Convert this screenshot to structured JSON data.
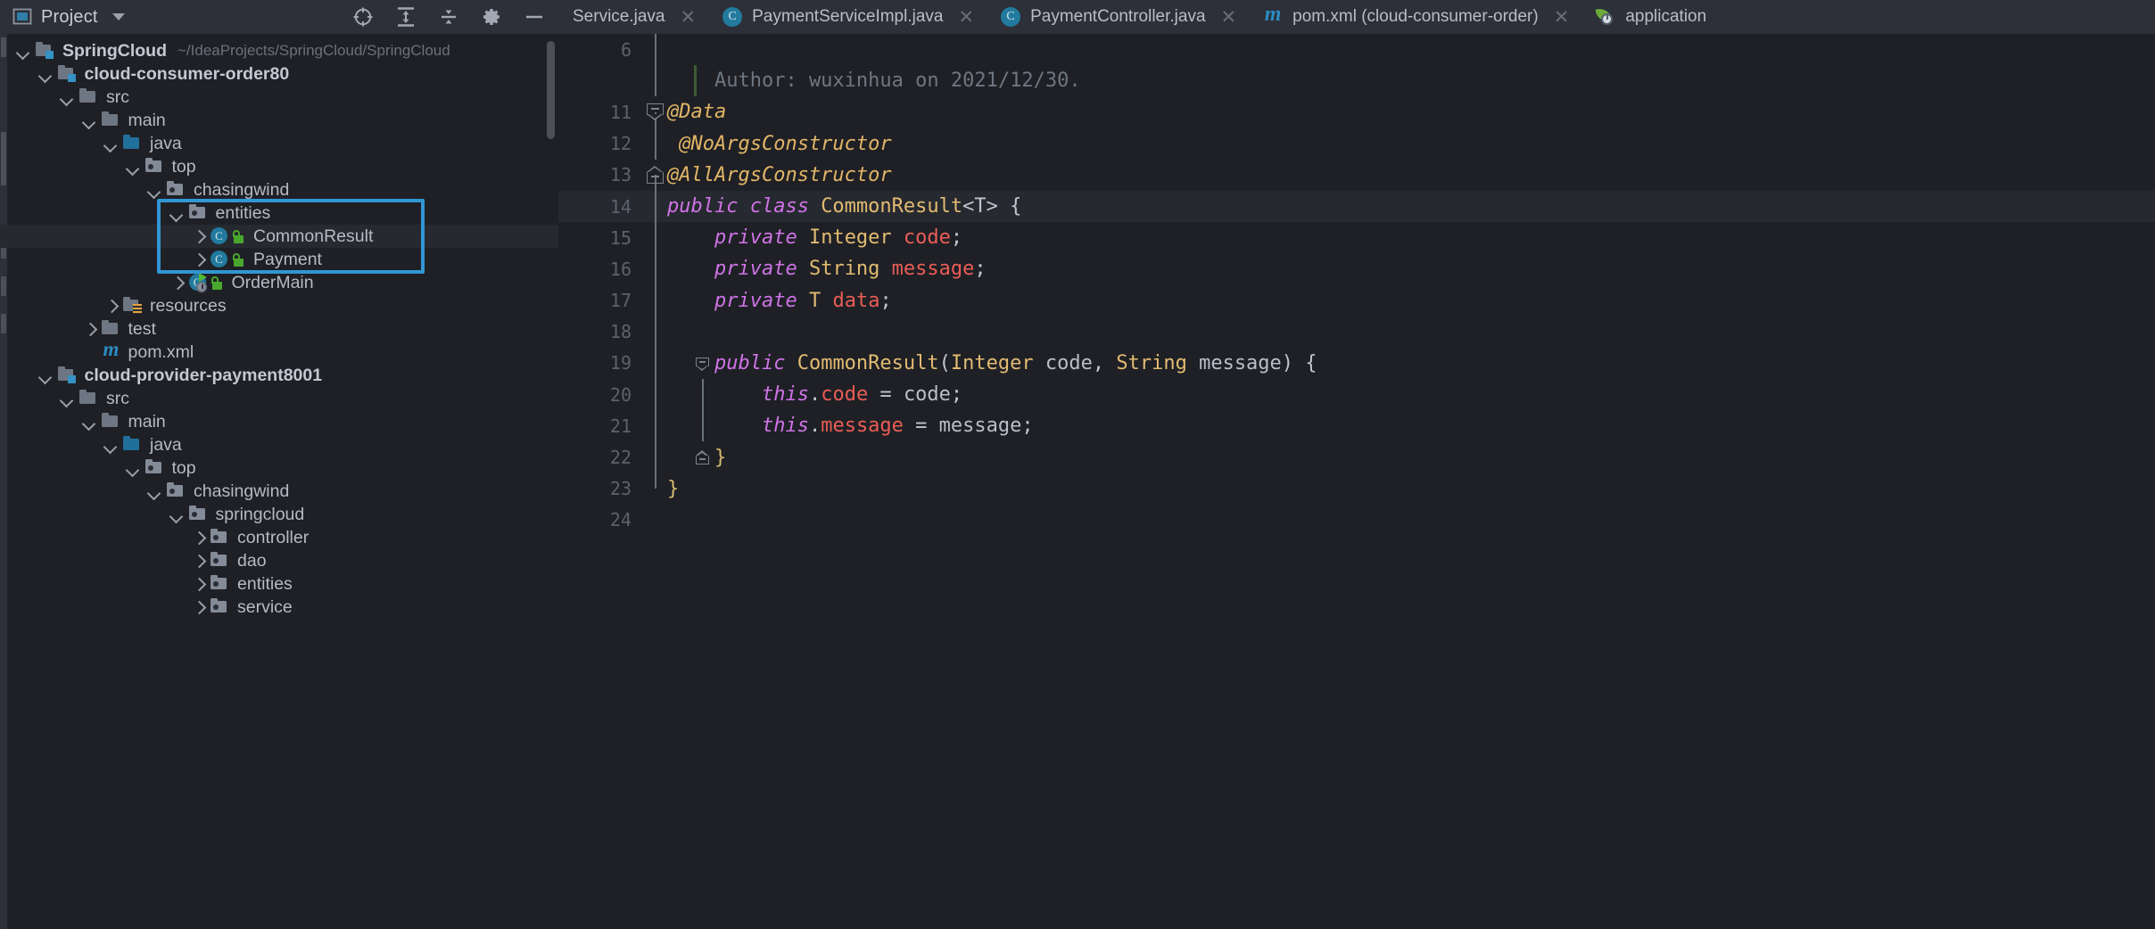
{
  "project_panel": {
    "title": "Project",
    "dropdown_icon": "chevron-down-icon",
    "toolbar": [
      {
        "name": "select-opened-file-icon",
        "label": "Select Opened File"
      },
      {
        "name": "expand-all-icon",
        "label": "Expand All"
      },
      {
        "name": "collapse-all-icon",
        "label": "Collapse All"
      },
      {
        "name": "settings-gear-icon",
        "label": "Settings"
      },
      {
        "name": "hide-panel-icon",
        "label": "Hide"
      }
    ],
    "tree": [
      {
        "label": "SpringCloud",
        "suffix": "~/IdeaProjects/SpringCloud/SpringCloud",
        "icon": "module-icon",
        "depth": 0,
        "twisty": "down",
        "bold": true,
        "selected": false,
        "highlighted": false
      },
      {
        "label": "cloud-consumer-order80",
        "suffix": "",
        "icon": "module-icon",
        "depth": 1,
        "twisty": "down",
        "bold": true,
        "selected": false,
        "highlighted": false
      },
      {
        "label": "src",
        "suffix": "",
        "icon": "folder-icon",
        "depth": 2,
        "twisty": "down",
        "bold": false,
        "selected": false,
        "highlighted": false
      },
      {
        "label": "main",
        "suffix": "",
        "icon": "folder-icon",
        "depth": 3,
        "twisty": "down",
        "bold": false,
        "selected": false,
        "highlighted": false
      },
      {
        "label": "java",
        "suffix": "",
        "icon": "source-root-folder-icon",
        "depth": 4,
        "twisty": "down",
        "bold": false,
        "selected": false,
        "highlighted": false
      },
      {
        "label": "top",
        "suffix": "",
        "icon": "package-icon",
        "depth": 5,
        "twisty": "down",
        "bold": false,
        "selected": false,
        "highlighted": false
      },
      {
        "label": "chasingwind",
        "suffix": "",
        "icon": "package-icon",
        "depth": 6,
        "twisty": "down",
        "bold": false,
        "selected": false,
        "highlighted": false
      },
      {
        "label": "entities",
        "suffix": "",
        "icon": "package-icon",
        "depth": 7,
        "twisty": "down",
        "bold": false,
        "selected": false,
        "highlighted": true
      },
      {
        "label": "CommonResult",
        "suffix": "",
        "icon": "java-class-icon",
        "depth": 8,
        "twisty": "right",
        "bold": false,
        "selected": true,
        "highlighted": true
      },
      {
        "label": "Payment",
        "suffix": "",
        "icon": "java-class-icon",
        "depth": 8,
        "twisty": "right",
        "bold": false,
        "selected": false,
        "highlighted": true
      },
      {
        "label": "OrderMain",
        "suffix": "",
        "icon": "java-runnable-class-icon",
        "depth": 7,
        "twisty": "right",
        "bold": false,
        "selected": false,
        "highlighted": false
      },
      {
        "label": "resources",
        "suffix": "",
        "icon": "resources-folder-icon",
        "depth": 4,
        "twisty": "right",
        "bold": false,
        "selected": false,
        "highlighted": false
      },
      {
        "label": "test",
        "suffix": "",
        "icon": "folder-icon",
        "depth": 3,
        "twisty": "right",
        "bold": false,
        "selected": false,
        "highlighted": false
      },
      {
        "label": "pom.xml",
        "suffix": "",
        "icon": "maven-icon",
        "depth": 3,
        "twisty": "none",
        "bold": false,
        "selected": false,
        "highlighted": false
      },
      {
        "label": "cloud-provider-payment8001",
        "suffix": "",
        "icon": "module-icon",
        "depth": 1,
        "twisty": "down",
        "bold": true,
        "selected": false,
        "highlighted": false
      },
      {
        "label": "src",
        "suffix": "",
        "icon": "folder-icon",
        "depth": 2,
        "twisty": "down",
        "bold": false,
        "selected": false,
        "highlighted": false
      },
      {
        "label": "main",
        "suffix": "",
        "icon": "folder-icon",
        "depth": 3,
        "twisty": "down",
        "bold": false,
        "selected": false,
        "highlighted": false
      },
      {
        "label": "java",
        "suffix": "",
        "icon": "source-root-folder-icon",
        "depth": 4,
        "twisty": "down",
        "bold": false,
        "selected": false,
        "highlighted": false
      },
      {
        "label": "top",
        "suffix": "",
        "icon": "package-icon",
        "depth": 5,
        "twisty": "down",
        "bold": false,
        "selected": false,
        "highlighted": false
      },
      {
        "label": "chasingwind",
        "suffix": "",
        "icon": "package-icon",
        "depth": 6,
        "twisty": "down",
        "bold": false,
        "selected": false,
        "highlighted": false
      },
      {
        "label": "springcloud",
        "suffix": "",
        "icon": "package-icon",
        "depth": 7,
        "twisty": "down",
        "bold": false,
        "selected": false,
        "highlighted": false
      },
      {
        "label": "controller",
        "suffix": "",
        "icon": "package-icon",
        "depth": 8,
        "twisty": "right",
        "bold": false,
        "selected": false,
        "highlighted": false
      },
      {
        "label": "dao",
        "suffix": "",
        "icon": "package-icon",
        "depth": 8,
        "twisty": "right",
        "bold": false,
        "selected": false,
        "highlighted": false
      },
      {
        "label": "entities",
        "suffix": "",
        "icon": "package-icon",
        "depth": 8,
        "twisty": "right",
        "bold": false,
        "selected": false,
        "highlighted": false
      },
      {
        "label": "service",
        "suffix": "",
        "icon": "package-icon",
        "depth": 8,
        "twisty": "right",
        "bold": false,
        "selected": false,
        "highlighted": false
      }
    ],
    "highlight_color": "#3296d4"
  },
  "editor": {
    "tabs": [
      {
        "label": "Service.java",
        "icon": "java-class-icon",
        "active": false,
        "truncated_left": true,
        "closable": true
      },
      {
        "label": "PaymentServiceImpl.java",
        "icon": "java-class-icon",
        "active": false,
        "closable": true
      },
      {
        "label": "PaymentController.java",
        "icon": "java-class-icon",
        "active": false,
        "closable": true
      },
      {
        "label": "pom.xml (cloud-consumer-order)",
        "icon": "maven-icon",
        "active": false,
        "closable": true
      },
      {
        "label": "application",
        "icon": "spring-icon",
        "active": false,
        "closable": false
      }
    ],
    "lines": [
      {
        "num": "6",
        "fold": "line-full",
        "current": false,
        "tokens": []
      },
      {
        "num": "",
        "fold": "line-full",
        "current": false,
        "comment_bar": true,
        "tokens": [
          {
            "t": "    Author: wuxinhua on 2021/12/30.",
            "c": "cm"
          }
        ]
      },
      {
        "num": "11",
        "fold": "box-down",
        "current": false,
        "tokens": [
          {
            "t": "@Data",
            "c": "an"
          }
        ]
      },
      {
        "num": "12",
        "fold": "line-full",
        "current": false,
        "tokens": [
          {
            "t": " @NoArgsConstructor",
            "c": "an"
          }
        ]
      },
      {
        "num": "13",
        "fold": "box-up",
        "current": false,
        "tokens": [
          {
            "t": "@AllArgsConstructor",
            "c": "an"
          }
        ]
      },
      {
        "num": "14",
        "fold": "line-full",
        "current": true,
        "tokens": [
          {
            "t": "public class ",
            "c": "k"
          },
          {
            "t": "CommonResult",
            "c": "ty"
          },
          {
            "t": "<T> {",
            "c": "op"
          }
        ]
      },
      {
        "num": "15",
        "fold": "line-full",
        "current": false,
        "tokens": [
          {
            "t": "    ",
            "c": "op"
          },
          {
            "t": "private ",
            "c": "k"
          },
          {
            "t": "Integer ",
            "c": "ty"
          },
          {
            "t": "code",
            "c": "fd"
          },
          {
            "t": ";",
            "c": "op"
          }
        ]
      },
      {
        "num": "16",
        "fold": "line-full",
        "current": false,
        "tokens": [
          {
            "t": "    ",
            "c": "op"
          },
          {
            "t": "private ",
            "c": "k"
          },
          {
            "t": "String ",
            "c": "ty"
          },
          {
            "t": "message",
            "c": "fd"
          },
          {
            "t": ";",
            "c": "op"
          }
        ]
      },
      {
        "num": "17",
        "fold": "line-full",
        "current": false,
        "tokens": [
          {
            "t": "    ",
            "c": "op"
          },
          {
            "t": "private ",
            "c": "k"
          },
          {
            "t": "T ",
            "c": "ty"
          },
          {
            "t": "data",
            "c": "fd"
          },
          {
            "t": ";",
            "c": "op"
          }
        ]
      },
      {
        "num": "18",
        "fold": "line-full",
        "current": false,
        "tokens": []
      },
      {
        "num": "19",
        "fold": "box-down-inner",
        "current": false,
        "tokens": [
          {
            "t": "    ",
            "c": "op"
          },
          {
            "t": "public ",
            "c": "k"
          },
          {
            "t": "CommonResult",
            "c": "ty"
          },
          {
            "t": "(",
            "c": "op"
          },
          {
            "t": "Integer ",
            "c": "ty"
          },
          {
            "t": "code",
            "c": "pn"
          },
          {
            "t": ", ",
            "c": "op"
          },
          {
            "t": "String ",
            "c": "ty"
          },
          {
            "t": "message",
            "c": "pn"
          },
          {
            "t": ") {",
            "c": "op"
          }
        ]
      },
      {
        "num": "20",
        "fold": "line-inner",
        "current": false,
        "tokens": [
          {
            "t": "        ",
            "c": "op"
          },
          {
            "t": "this",
            "c": "k"
          },
          {
            "t": ".",
            "c": "op"
          },
          {
            "t": "code",
            "c": "fd"
          },
          {
            "t": " = ",
            "c": "op"
          },
          {
            "t": "code",
            "c": "pn"
          },
          {
            "t": ";",
            "c": "op"
          }
        ]
      },
      {
        "num": "21",
        "fold": "line-inner",
        "current": false,
        "tokens": [
          {
            "t": "        ",
            "c": "op"
          },
          {
            "t": "this",
            "c": "k"
          },
          {
            "t": ".",
            "c": "op"
          },
          {
            "t": "message",
            "c": "fd"
          },
          {
            "t": " = ",
            "c": "op"
          },
          {
            "t": "message",
            "c": "pn"
          },
          {
            "t": ";",
            "c": "op"
          }
        ]
      },
      {
        "num": "22",
        "fold": "box-up-inner",
        "current": false,
        "tokens": [
          {
            "t": "    }",
            "c": "br"
          }
        ]
      },
      {
        "num": "23",
        "fold": "line-end",
        "current": false,
        "tokens": [
          {
            "t": "}",
            "c": "br"
          }
        ]
      },
      {
        "num": "24",
        "fold": "none",
        "current": false,
        "tokens": []
      }
    ]
  }
}
